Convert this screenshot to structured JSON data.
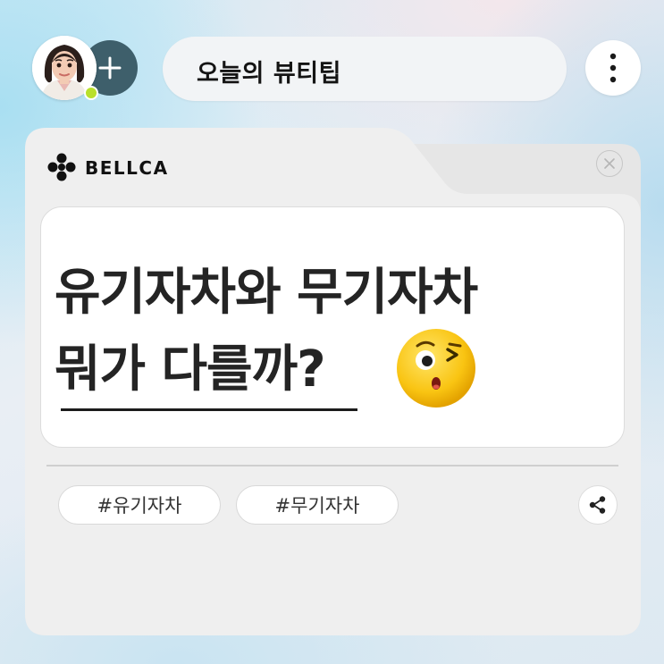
{
  "header": {
    "title": "오늘의 뷰티팁",
    "add_icon": "plus-icon",
    "more_icon": "vertical-dots-icon"
  },
  "brand": {
    "name": "BELLCA",
    "logo_icon": "bellca-logo-icon",
    "close_icon": "close-icon"
  },
  "headline": {
    "line1": "유기자차와 무기자차",
    "line2": "뭐가 다를까?",
    "emoji": "winking-kiss-emoji"
  },
  "tags": [
    {
      "label": "#유기자차"
    },
    {
      "label": "#무기자차"
    }
  ],
  "share_icon": "share-icon",
  "colors": {
    "add_circle": "#3e5f6b",
    "status_online": "#b9e02b",
    "card_bg": "#efefef",
    "headline_text": "#242424"
  }
}
